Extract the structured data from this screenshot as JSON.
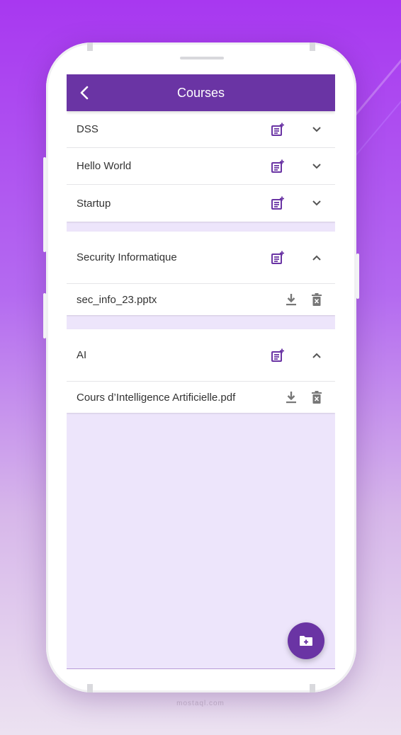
{
  "app": {
    "title": "Courses",
    "accent_color": "#6a34a4",
    "watermark": "mostaql.com"
  },
  "courses": [
    {
      "name": "DSS",
      "expanded": false
    },
    {
      "name": "Hello World",
      "expanded": false
    },
    {
      "name": "Startup",
      "expanded": false
    },
    {
      "name": "Security Informatique",
      "expanded": true,
      "files": [
        "sec_info_23.pptx"
      ]
    },
    {
      "name": "AI",
      "expanded": true,
      "files": [
        "Cours d’Intelligence Artificielle.pdf"
      ]
    }
  ],
  "icons": {
    "back": "chevron-left-icon",
    "add_file": "note-add-icon",
    "expand": "chevron-down-icon",
    "collapse": "chevron-up-icon",
    "download": "download-icon",
    "delete": "delete-icon",
    "fab": "create-folder-icon"
  }
}
